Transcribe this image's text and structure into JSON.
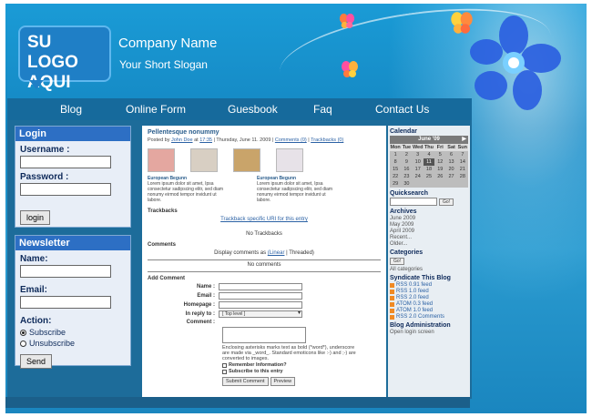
{
  "header": {
    "logo_text": "SU LOGO AQUI",
    "company_name": "Company Name",
    "slogan": "Your Short Slogan"
  },
  "nav": {
    "items": [
      "Blog",
      "Online Form",
      "Guesbook",
      "Faq",
      "Contact Us"
    ]
  },
  "login": {
    "title": "Login",
    "username_label": "Username :",
    "password_label": "Password :",
    "button": "login"
  },
  "newsletter": {
    "title": "Newsletter",
    "name_label": "Name:",
    "email_label": "Email:",
    "action_label": "Action:",
    "subscribe": "Subscribe",
    "unsubscribe": "Unsubscribe",
    "send": "Send"
  },
  "post": {
    "title": "Pellentesque nonummy",
    "meta_prefix": "Posted by",
    "author": "John Doe",
    "at": "at",
    "time": "17:35",
    "date": "| Thursday, June 11. 2009 |",
    "comments_link": "Comments (0)",
    "sep": "|",
    "trackbacks_link": "Trackbacks (0)",
    "caption1_title": "European Begunn",
    "caption1_text": "Lorem ipsum dolor sit amet, Ipsa consectetur sadipscing elitr, sed diam nonumy eirmod tempor invidunt ut labore.",
    "caption2_title": "European Begunn",
    "caption2_text": "Lorem ipsum dolor sit amet, Ipsa consectetur sadipscing elitr, sed diam nonumy eirmod tempor invidunt ut labore.",
    "trackbacks_heading": "Trackbacks",
    "trackback_uri": "Trackback specific URI for this entry",
    "no_trackbacks": "No Trackbacks",
    "comments_heading": "Comments",
    "display_comments": "Display comments as",
    "linear": "(Linear",
    "threaded": "| Threaded)",
    "no_comments": "No comments",
    "add_comment": "Add Comment",
    "name_lbl": "Name :",
    "email_lbl": "Email :",
    "homepage_lbl": "Homepage :",
    "reply_lbl": "In reply to :",
    "reply_value": "[ Top level ]",
    "comment_lbl": "Comment :",
    "hint": "Enclosing asterisks marks text as bold (*word*), underscore are made via _word_. Standard emoticons like :-) and ;-) are converted to images.",
    "remember": "Remember Information?",
    "subscribe_entry": "Subscribe to this entry",
    "submit": "Submit Comment",
    "preview": "Preview"
  },
  "sidebar": {
    "calendar_title": "Calendar",
    "month": "June '09",
    "dows": [
      "Mon",
      "Tue",
      "Wed",
      "Thu",
      "Fri",
      "Sat",
      "Sun"
    ],
    "days": [
      "1",
      "2",
      "3",
      "4",
      "5",
      "6",
      "7",
      "8",
      "9",
      "10",
      "11",
      "12",
      "13",
      "14",
      "15",
      "16",
      "17",
      "18",
      "19",
      "20",
      "21",
      "22",
      "23",
      "24",
      "25",
      "26",
      "27",
      "28",
      "29",
      "30",
      "",
      "",
      "",
      "",
      ""
    ],
    "quicksearch": "Quicksearch",
    "go": "Go!",
    "archives": "Archives",
    "archive_items": [
      "June 2009",
      "May 2009",
      "April 2009",
      "Recent...",
      "Older..."
    ],
    "categories": "Categories",
    "cat_go": "Go!",
    "all_categories": "All categories",
    "syndicate": "Syndicate This Blog",
    "feeds": [
      "RSS 0.91 feed",
      "RSS 1.0 feed",
      "RSS 2.0 feed",
      "ATOM 0.3 feed",
      "ATOM 1.0 feed",
      "RSS 2.0 Comments"
    ],
    "blog_admin": "Blog Administration",
    "open_login": "Open login screen"
  },
  "colors": {
    "bg_blue": "#1a9bd6",
    "nav_bar": "#166a9c",
    "panel_head": "#2d6fc4"
  }
}
